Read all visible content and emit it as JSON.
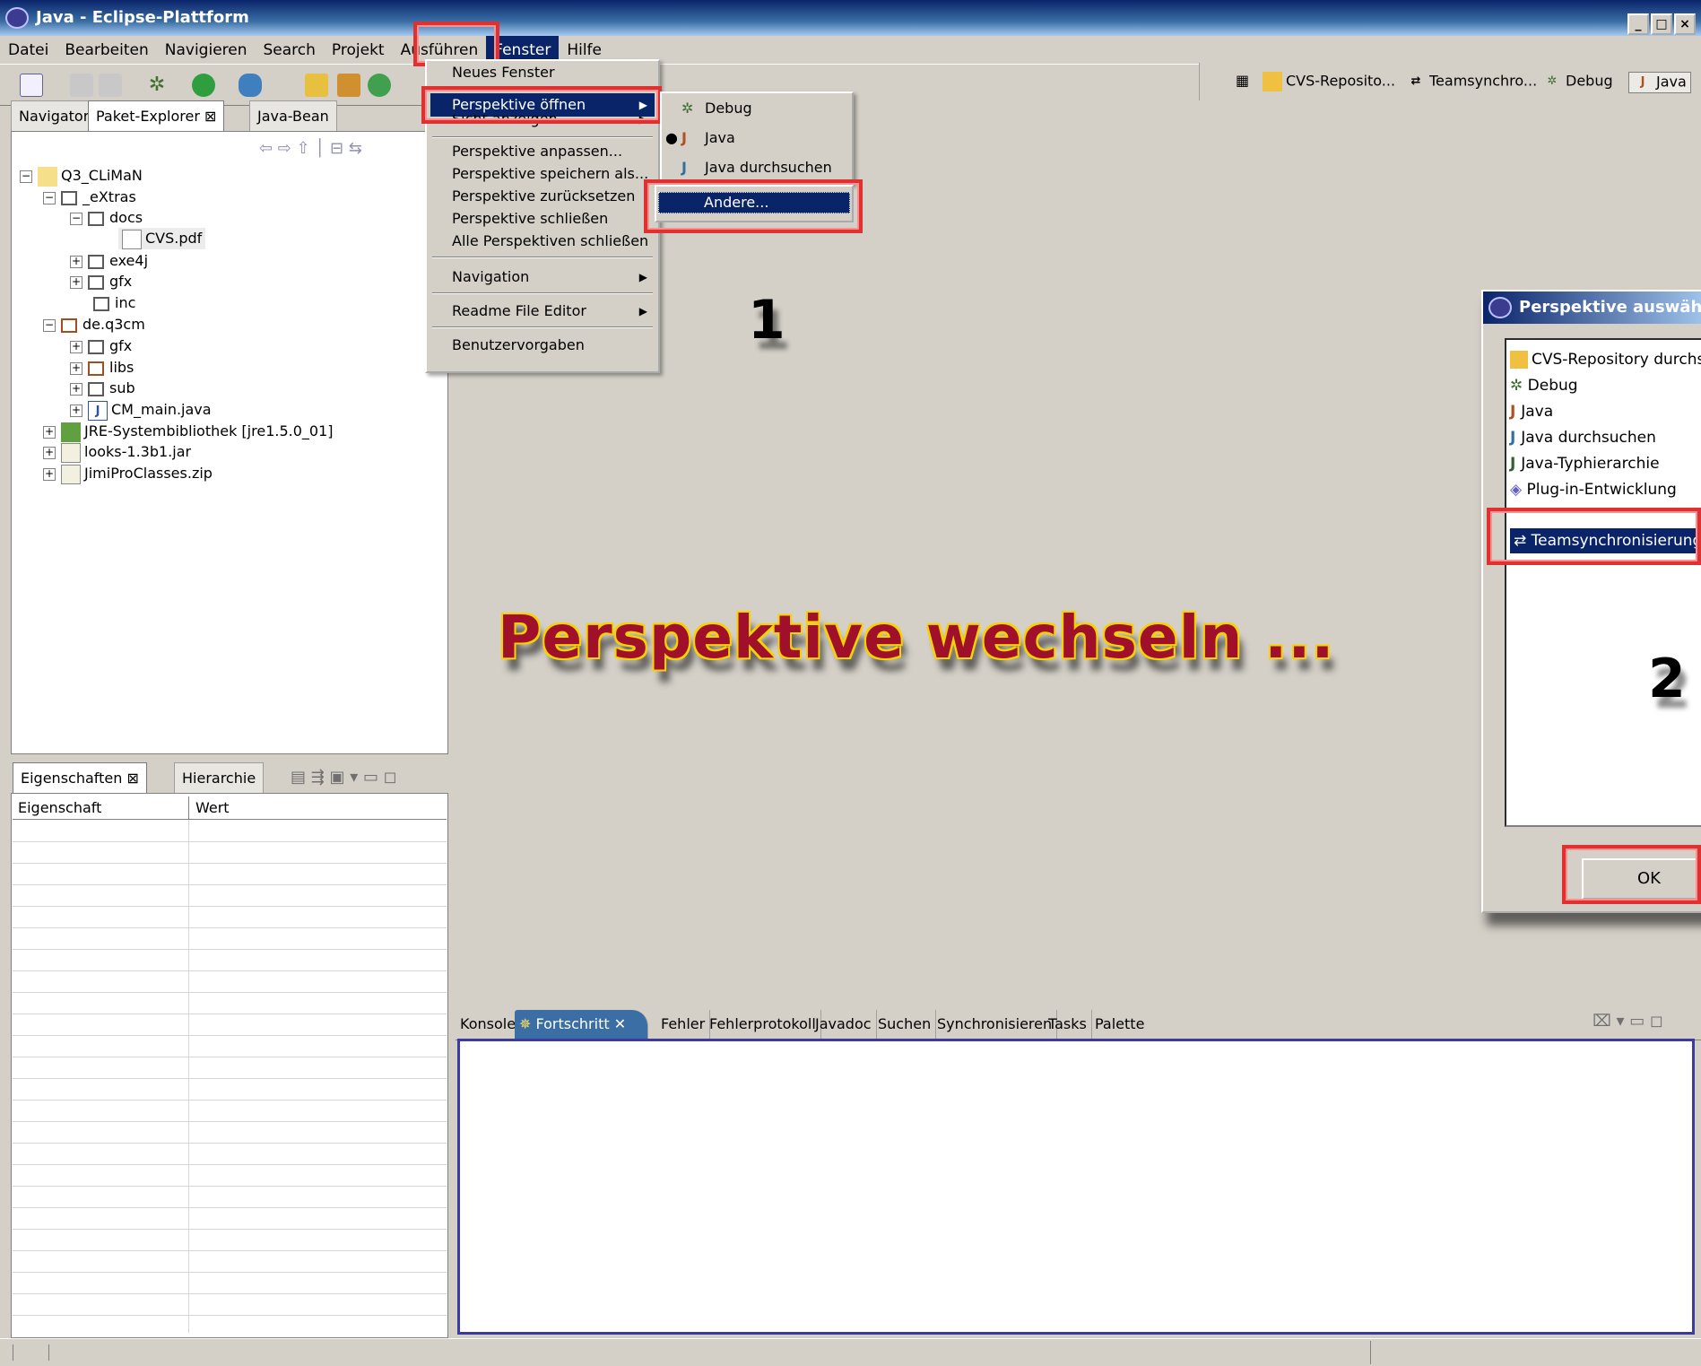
{
  "window": {
    "title": "Java - Eclipse-Plattform"
  },
  "menubar": [
    "Datei",
    "Bearbeiten",
    "Navigieren",
    "Search",
    "Projekt",
    "Ausführen",
    "Fenster",
    "Hilfe"
  ],
  "perspective_bar": {
    "items": [
      "CVS-Reposito...",
      "Teamsynchro...",
      "Debug",
      "Java"
    ]
  },
  "left_panel": {
    "tabs": [
      "Navigator",
      "Paket-Explorer",
      "Java-Bean"
    ],
    "tree": [
      "Q3_CLiMaN",
      "_eXtras",
      "docs",
      "CVS.pdf",
      "exe4j",
      "gfx",
      "inc",
      "de.q3cm",
      "gfx",
      "libs",
      "sub",
      "CM_main.java",
      "JRE-Systembibliothek [jre1.5.0_01]",
      "looks-1.3b1.jar",
      "JimiProClasses.zip"
    ]
  },
  "properties_panel": {
    "tabs": [
      "Eigenschaften",
      "Hierarchie"
    ],
    "columns": [
      "Eigenschaft",
      "Wert"
    ]
  },
  "fenster_menu": {
    "items": [
      "Neues Fenster",
      "Perspektive öffnen",
      "Sicht anzeigen",
      "Perspektive anpassen...",
      "Perspektive speichern als...",
      "Perspektive zurücksetzen",
      "Perspektive schließen",
      "Alle Perspektiven schließen",
      "Navigation",
      "Readme File Editor",
      "Benutzervorgaben"
    ]
  },
  "perspective_submenu": {
    "items": [
      "Debug",
      "Java",
      "Java durchsuchen",
      "Andere..."
    ]
  },
  "bottom_panel": {
    "tabs": [
      "Konsole",
      "Fortschritt",
      "Fehler",
      "Fehlerprotokoll",
      "Javadoc",
      "Suchen",
      "Synchronisieren",
      "Tasks",
      "Palette"
    ]
  },
  "dialog": {
    "title": "Perspektive auswähle",
    "items": [
      "CVS-Repository durchs",
      "Debug",
      "Java",
      "Java durchsuchen",
      "Java-Typhierarchie",
      "Plug-in-Entwicklung",
      "Teamsynchronisierung"
    ],
    "ok": "OK"
  },
  "annotations": {
    "caption": "Perspektive wechseln ...",
    "step1": "1",
    "step2": "2"
  }
}
